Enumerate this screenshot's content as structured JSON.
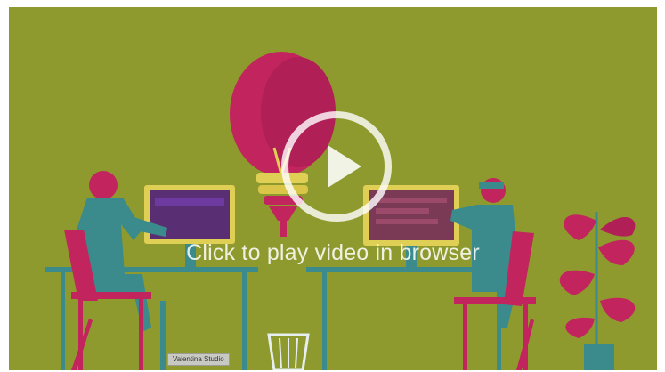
{
  "video": {
    "play_caption": "Click to play video in browser",
    "credit": "Valentina Studio"
  },
  "icons": {
    "play": "play-icon"
  },
  "colors": {
    "background": "#8f9a2e",
    "magenta": "#c2245e",
    "teal": "#3b8b8d",
    "bulb_yellow": "#e0cf55"
  }
}
